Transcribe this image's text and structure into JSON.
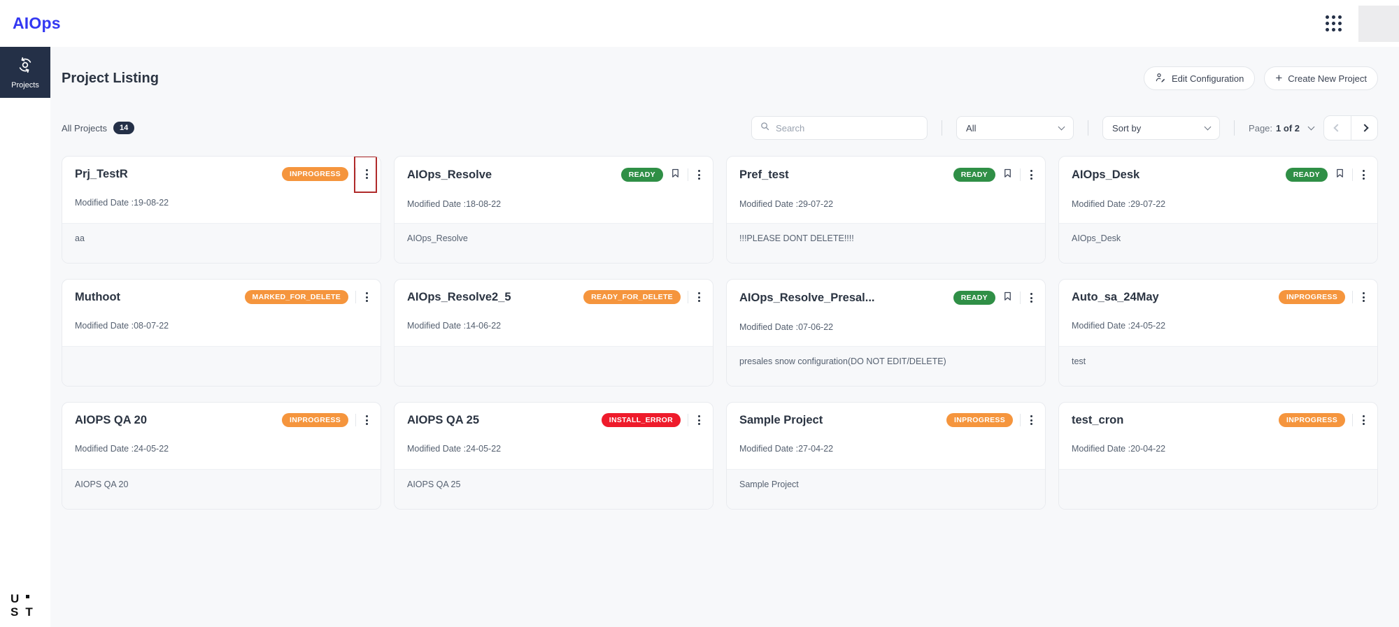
{
  "app": {
    "logo": "AIOps"
  },
  "sidebar": {
    "active_item": {
      "label": "Projects"
    }
  },
  "ust_logo": {
    "u": "U",
    "s": "S",
    "t": "T"
  },
  "header": {
    "title": "Project Listing",
    "buttons": {
      "edit_configuration": "Edit Configuration",
      "create_new_project": "Create New Project"
    }
  },
  "filters": {
    "all_projects_label": "All Projects",
    "project_count": "14",
    "search_placeholder": "Search",
    "type_filter_value": "All",
    "sort_placeholder": "Sort by",
    "page_label": "Page:",
    "page_value": "1 of 2"
  },
  "colors": {
    "accent_blue": "#3338f2",
    "navy": "#243047",
    "badge_orange": "#f5953d",
    "badge_green": "#2f8f46",
    "badge_red": "#ee1b2b",
    "annotation_red": "#b02a2a"
  },
  "cards": [
    {
      "name": "Prj_TestR",
      "status": "INPROGRESS",
      "status_color": "orange",
      "modified": "Modified Date :19-08-22",
      "description": "aa",
      "bookmark": false,
      "annotated": true
    },
    {
      "name": "AIOps_Resolve",
      "status": "READY",
      "status_color": "green",
      "modified": "Modified Date :18-08-22",
      "description": "AIOps_Resolve",
      "bookmark": true,
      "annotated": false
    },
    {
      "name": "Pref_test",
      "status": "READY",
      "status_color": "green",
      "modified": "Modified Date :29-07-22",
      "description": "!!!PLEASE DONT DELETE!!!!",
      "bookmark": true,
      "annotated": false
    },
    {
      "name": "AIOps_Desk",
      "status": "READY",
      "status_color": "green",
      "modified": "Modified Date :29-07-22",
      "description": "AIOps_Desk",
      "bookmark": true,
      "annotated": false
    },
    {
      "name": "Muthoot",
      "status": "MARKED_FOR_DELETE",
      "status_color": "orange",
      "modified": "Modified Date :08-07-22",
      "description": "",
      "bookmark": false,
      "annotated": false
    },
    {
      "name": "AIOps_Resolve2_5",
      "status": "READY_FOR_DELETE",
      "status_color": "orange",
      "modified": "Modified Date :14-06-22",
      "description": "",
      "bookmark": false,
      "annotated": false
    },
    {
      "name": "AIOps_Resolve_Presal...",
      "status": "READY",
      "status_color": "green",
      "modified": "Modified Date :07-06-22",
      "description": "presales snow configuration(DO NOT EDIT/DELETE)",
      "bookmark": true,
      "annotated": false
    },
    {
      "name": "Auto_sa_24May",
      "status": "INPROGRESS",
      "status_color": "orange",
      "modified": "Modified Date :24-05-22",
      "description": "test",
      "bookmark": false,
      "annotated": false
    },
    {
      "name": "AIOPS QA 20",
      "status": "INPROGRESS",
      "status_color": "orange",
      "modified": "Modified Date :24-05-22",
      "description": "AIOPS QA 20",
      "bookmark": false,
      "annotated": false
    },
    {
      "name": "AIOPS QA 25",
      "status": "INSTALL_ERROR",
      "status_color": "red",
      "modified": "Modified Date :24-05-22",
      "description": "AIOPS QA 25",
      "bookmark": false,
      "annotated": false
    },
    {
      "name": "Sample Project",
      "status": "INPROGRESS",
      "status_color": "orange",
      "modified": "Modified Date :27-04-22",
      "description": "Sample Project",
      "bookmark": false,
      "annotated": false
    },
    {
      "name": "test_cron",
      "status": "INPROGRESS",
      "status_color": "orange",
      "modified": "Modified Date :20-04-22",
      "description": "",
      "bookmark": false,
      "annotated": false
    }
  ]
}
